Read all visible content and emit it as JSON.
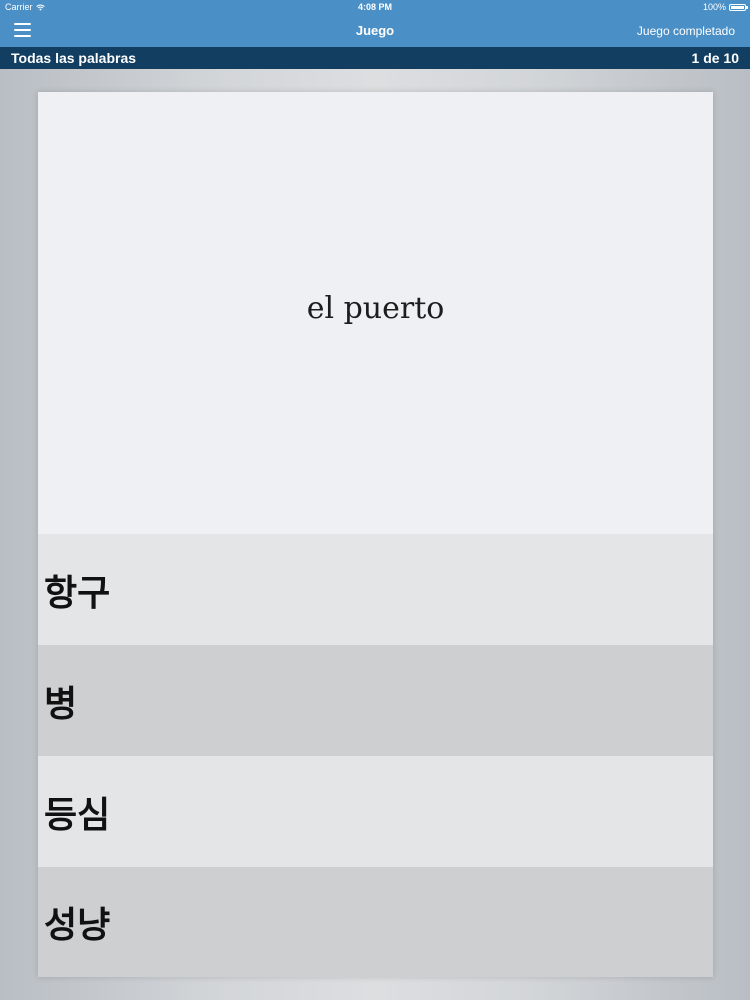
{
  "status_bar": {
    "carrier": "Carrier",
    "time": "4:08 PM",
    "battery": "100%"
  },
  "nav": {
    "menu_icon": "hamburger-menu-icon",
    "title": "Juego",
    "action_label": "Juego completado"
  },
  "sub_bar": {
    "category": "Todas las palabras",
    "progress": "1 de 10"
  },
  "quiz": {
    "prompt": "el puerto",
    "options": [
      {
        "label": "항구"
      },
      {
        "label": "병"
      },
      {
        "label": "등심"
      },
      {
        "label": "성냥"
      }
    ]
  },
  "colors": {
    "nav_background": "#4a8fc6",
    "sub_bar_background": "#123f61",
    "prompt_background": "#eef0f3",
    "option_light": "#e3e5e7",
    "option_dark": "#cdcfd1"
  }
}
